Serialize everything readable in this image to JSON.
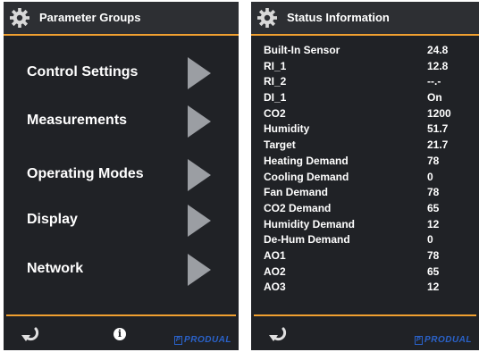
{
  "left_panel": {
    "title": "Parameter Groups",
    "menu_items": [
      {
        "label": "Control Settings"
      },
      {
        "label": "Measurements"
      },
      {
        "label": "Operating Modes"
      },
      {
        "label": "Display"
      },
      {
        "label": "Network"
      }
    ],
    "info_glyph": "i"
  },
  "right_panel": {
    "title": "Status Information",
    "rows": [
      {
        "label": "Built-In Sensor",
        "value": "24.8"
      },
      {
        "label": "RI_1",
        "value": "12.8"
      },
      {
        "label": "RI_2",
        "value": "--.-"
      },
      {
        "label": "DI_1",
        "value": "On"
      },
      {
        "label": "CO2",
        "value": "1200"
      },
      {
        "label": "Humidity",
        "value": "51.7"
      },
      {
        "label": "Target",
        "value": "21.7"
      },
      {
        "label": "Heating Demand",
        "value": "78"
      },
      {
        "label": "Cooling Demand",
        "value": "0"
      },
      {
        "label": "Fan Demand",
        "value": "78"
      },
      {
        "label": "CO2 Demand",
        "value": "65"
      },
      {
        "label": "Humidity Demand",
        "value": "12"
      },
      {
        "label": "De-Hum Demand",
        "value": "0"
      },
      {
        "label": "AO1",
        "value": "78"
      },
      {
        "label": "AO2",
        "value": "65"
      },
      {
        "label": "AO3",
        "value": "12"
      }
    ]
  },
  "brand": {
    "logo_mark": "P",
    "name": "PRODUAL"
  },
  "icons": {
    "header": "gear-icon",
    "back": "back-arrow-icon",
    "info": "info-icon"
  },
  "colors": {
    "accent": "#f0a030",
    "panel_bg": "#202226",
    "arrow": "#9b9ea3",
    "brand": "#2a62c9"
  }
}
